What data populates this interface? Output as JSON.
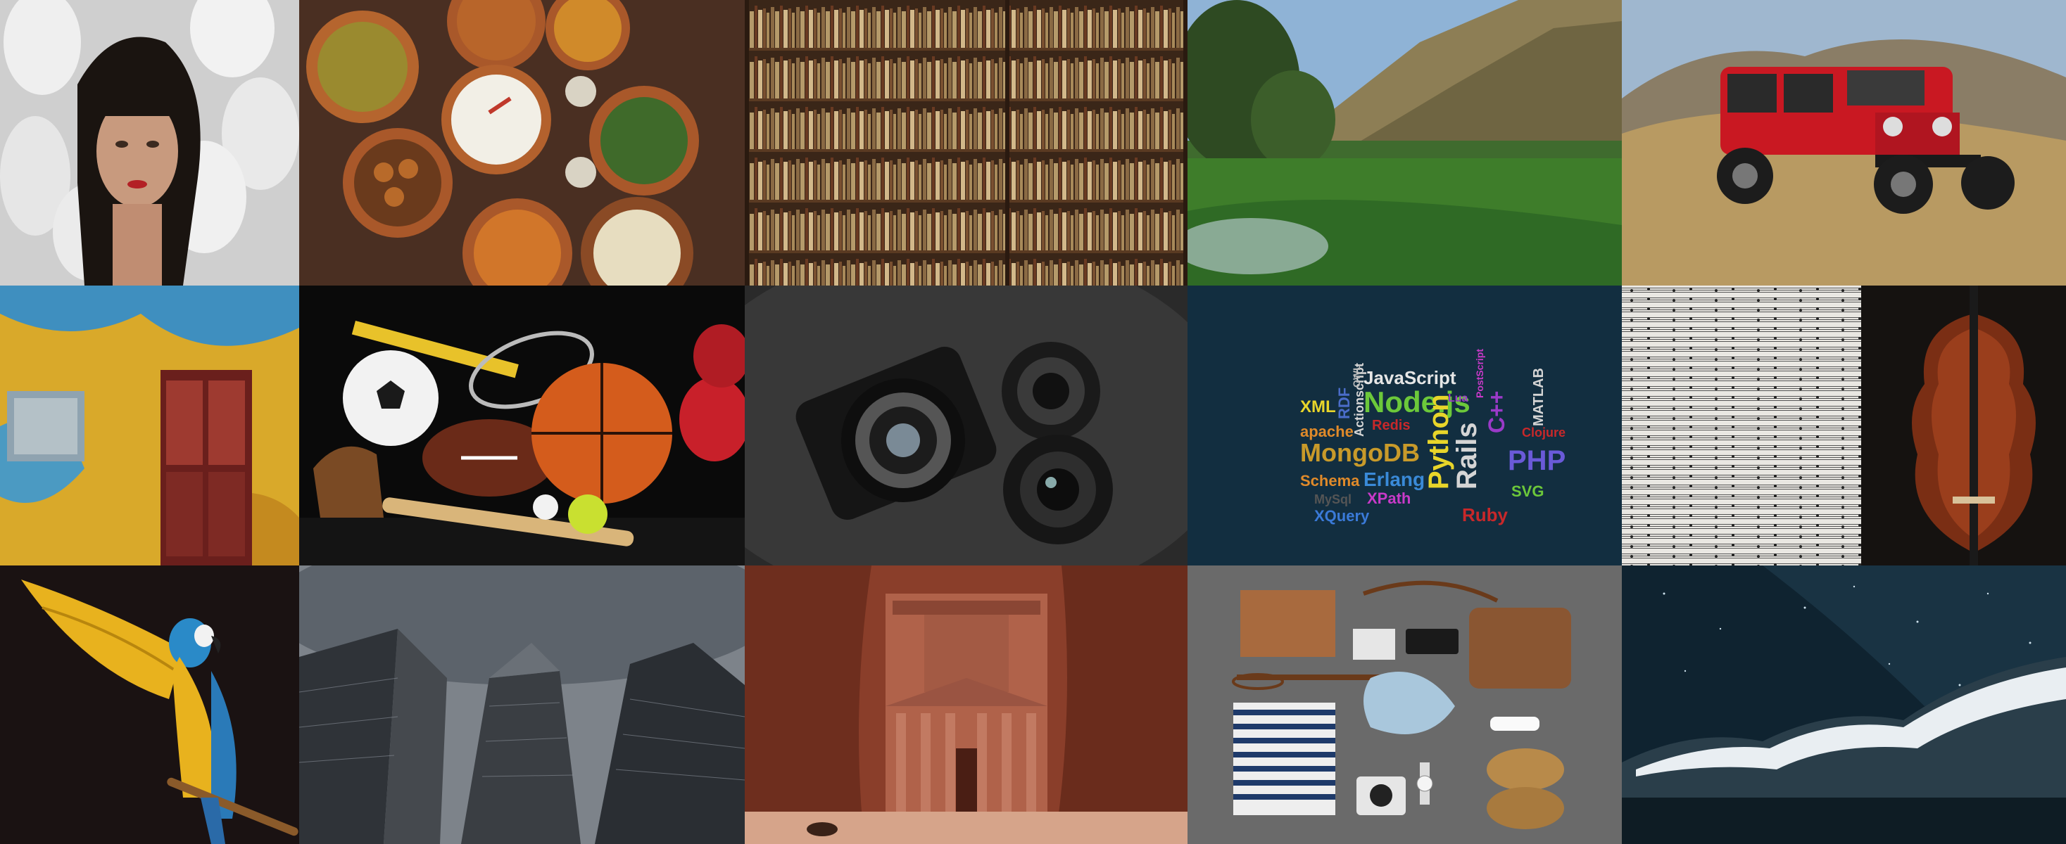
{
  "collage": {
    "tiles": [
      {
        "subject": "woman with white masks"
      },
      {
        "subject": "bowls of indian food"
      },
      {
        "subject": "library bookshelves"
      },
      {
        "subject": "mountain lake landscape"
      },
      {
        "subject": "red jeep in desert hills"
      },
      {
        "subject": "weathered yellow wall with door"
      },
      {
        "subject": "sports balls and equipment"
      },
      {
        "subject": "black camera and lenses"
      },
      {
        "subject": "programming languages word cloud"
      },
      {
        "subject": "violin on sheet music"
      },
      {
        "subject": "blue and yellow macaw"
      },
      {
        "subject": "skyscrapers from below"
      },
      {
        "subject": "petra treasury facade"
      },
      {
        "subject": "flat lay of clothes and accessories"
      },
      {
        "subject": "snowy mountain under milky way"
      }
    ]
  },
  "wordcloud": {
    "words": [
      "JavaScript",
      "XML",
      "RDF",
      "Node.js",
      "Actionscript",
      "apache",
      "Redis",
      "MongoDB",
      "Python",
      "Rails",
      "C++",
      "PHP",
      "Schema",
      "Erlang",
      "XPath",
      "XQuery",
      "Ruby",
      "SVG",
      "MySql",
      "PostScript",
      "MATLAB",
      "Clojure",
      "OWL",
      "Lua"
    ]
  }
}
